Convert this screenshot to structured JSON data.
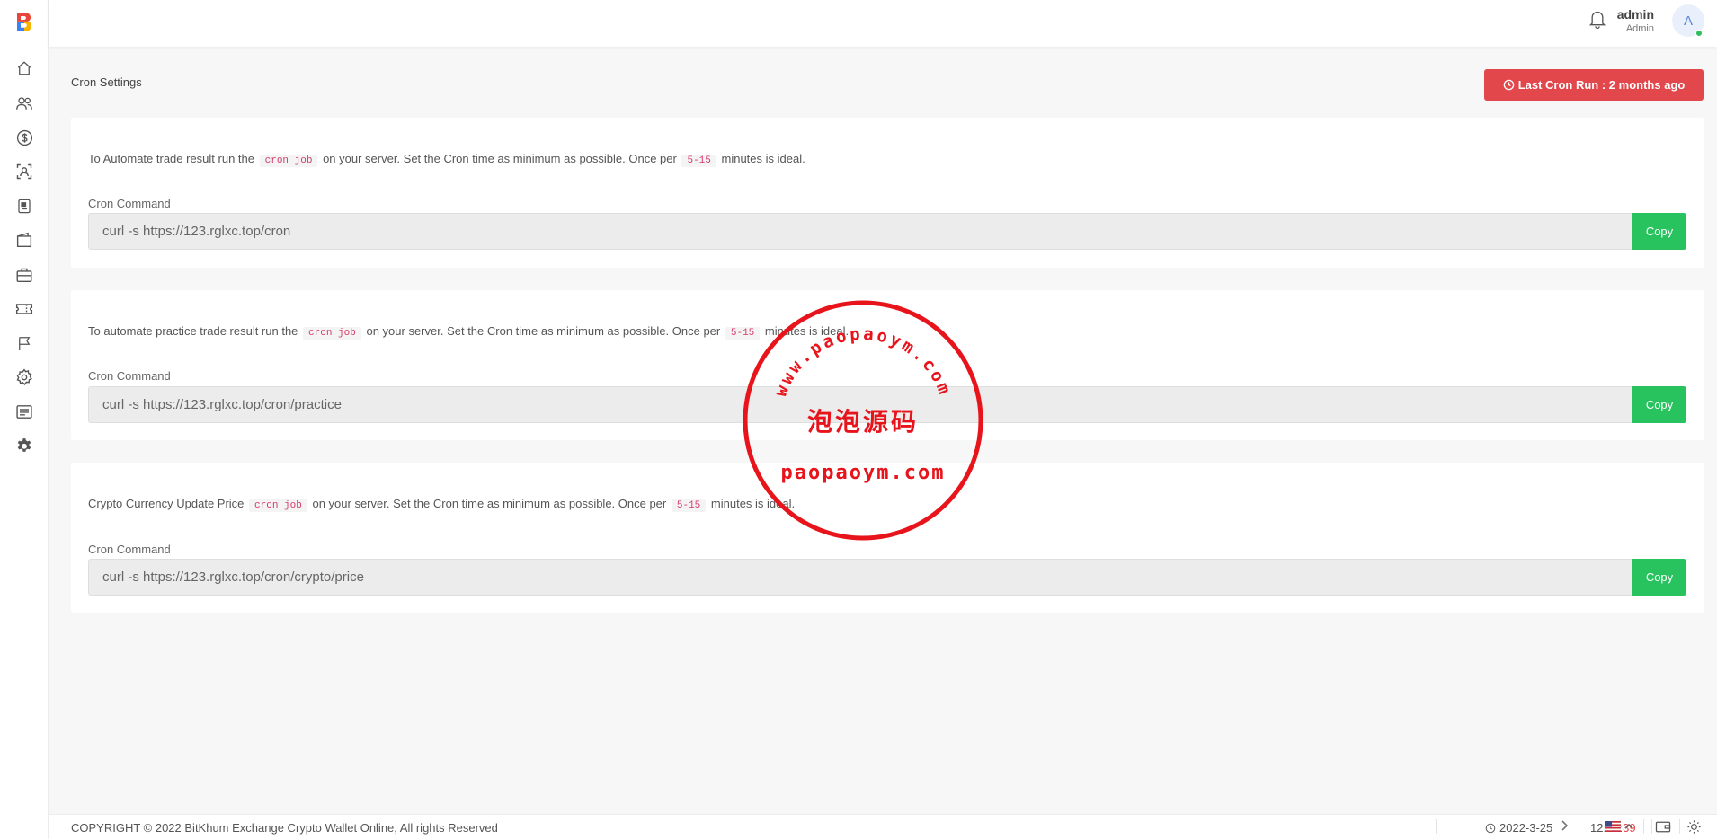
{
  "sidebar": {
    "logo_letter": "B",
    "items": [
      {
        "icon": "home-icon"
      },
      {
        "icon": "users-icon"
      },
      {
        "icon": "dollar-icon"
      },
      {
        "icon": "user-scan-icon"
      },
      {
        "icon": "document-icon"
      },
      {
        "icon": "wallet-icon"
      },
      {
        "icon": "briefcase-icon"
      },
      {
        "icon": "ticket-icon"
      },
      {
        "icon": "flag-icon"
      },
      {
        "icon": "settings-icon"
      },
      {
        "icon": "list-icon"
      },
      {
        "icon": "gear-icon"
      }
    ]
  },
  "header": {
    "user_name": "admin",
    "user_role": "Admin",
    "avatar_letter": "A"
  },
  "page": {
    "title": "Cron Settings",
    "last_cron_label": "Last Cron Run : 2 months ago"
  },
  "cards": [
    {
      "desc_before": "To Automate trade result run the",
      "chip1": "cron job",
      "desc_middle": "on your server. Set the Cron time as minimum as possible. Once per",
      "chip2": "5-15",
      "desc_after": "minutes is ideal.",
      "label": "Cron Command",
      "command": "curl -s https://123.rglxc.top/cron",
      "copy_label": "Copy"
    },
    {
      "desc_before": "To automate practice trade result run the",
      "chip1": "cron job",
      "desc_middle": "on your server. Set the Cron time as minimum as possible. Once per",
      "chip2": "5-15",
      "desc_after": "minutes is ideal.",
      "label": "Cron Command",
      "command": "curl -s https://123.rglxc.top/cron/practice",
      "copy_label": "Copy"
    },
    {
      "desc_before": "Crypto Currency Update Price",
      "chip1": "cron job",
      "desc_middle": "on your server. Set the Cron time as minimum as possible. Once per",
      "chip2": "5-15",
      "desc_after": "minutes is ideal.",
      "label": "Cron Command",
      "command": "curl -s https://123.rglxc.top/cron/crypto/price",
      "copy_label": "Copy"
    }
  ],
  "watermark": {
    "top_text": "www.paopaoym.com",
    "middle_text": "泡泡源码",
    "bottom_text": "paopaoym.com"
  },
  "footer": {
    "copyright": "COPYRIGHT © 2022 BitKhum Exchange Crypto Wallet Online, All rights Reserved",
    "date": "2022-3-25",
    "time_main": "12:32:",
    "time_seconds": "39"
  },
  "colors": {
    "accent_red": "#e2474c",
    "copy_green": "#28c35f",
    "chip_text": "#d63b6a",
    "stamp_red": "#e8141c"
  }
}
